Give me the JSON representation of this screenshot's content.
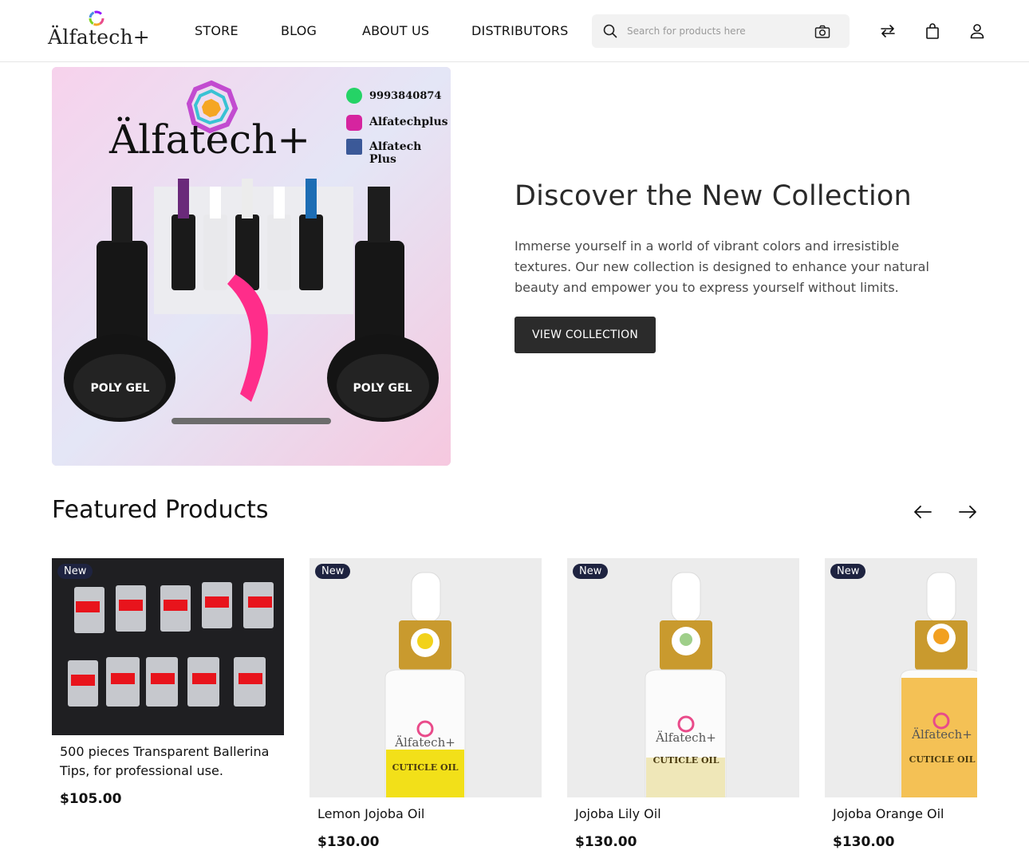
{
  "header": {
    "logo_text": "Älfatech+",
    "nav": [
      "STORE",
      "BLOG",
      "ABOUT US",
      "DISTRIBUTORS"
    ],
    "search_placeholder": "Search for products here"
  },
  "hero": {
    "image": {
      "brand": "Älfatech+",
      "whatsapp": "9993840874",
      "instagram": "Alfatechplus",
      "facebook": "Alfatech Plus",
      "product_left": "POLY GEL",
      "product_right": "POLY GEL"
    },
    "title": "Discover the New Collection",
    "description": "Immerse yourself in a world of vibrant colors and irresistible textures. Our new collection is designed to enhance your natural beauty and empower you to express yourself without limits.",
    "button_label": "VIEW COLLECTION"
  },
  "featured": {
    "title": "Featured Products",
    "products": [
      {
        "badge": "New",
        "name": "500 pieces Transparent Ballerina Tips, for professional use.",
        "price": "$105.00"
      },
      {
        "badge": "New",
        "name": "Lemon Jojoba Oil",
        "price": "$130.00",
        "label": "CUTICLE OIL",
        "brand": "Älfatech+",
        "liquid": "#f2e019"
      },
      {
        "badge": "New",
        "name": "Jojoba Lily Oil",
        "price": "$130.00",
        "label": "CUTICLE OIL",
        "brand": "Älfatech+",
        "liquid": "#efe7b8"
      },
      {
        "badge": "New",
        "name": "Jojoba Orange Oil",
        "price": "$130.00",
        "label": "CUTICLE OIL",
        "brand": "Älfatech+",
        "liquid": "#f2b637"
      }
    ]
  },
  "colors": {
    "accent_dark": "#2b2b2b",
    "badge": "#1e2340",
    "search_bg": "#f2f2f2"
  }
}
